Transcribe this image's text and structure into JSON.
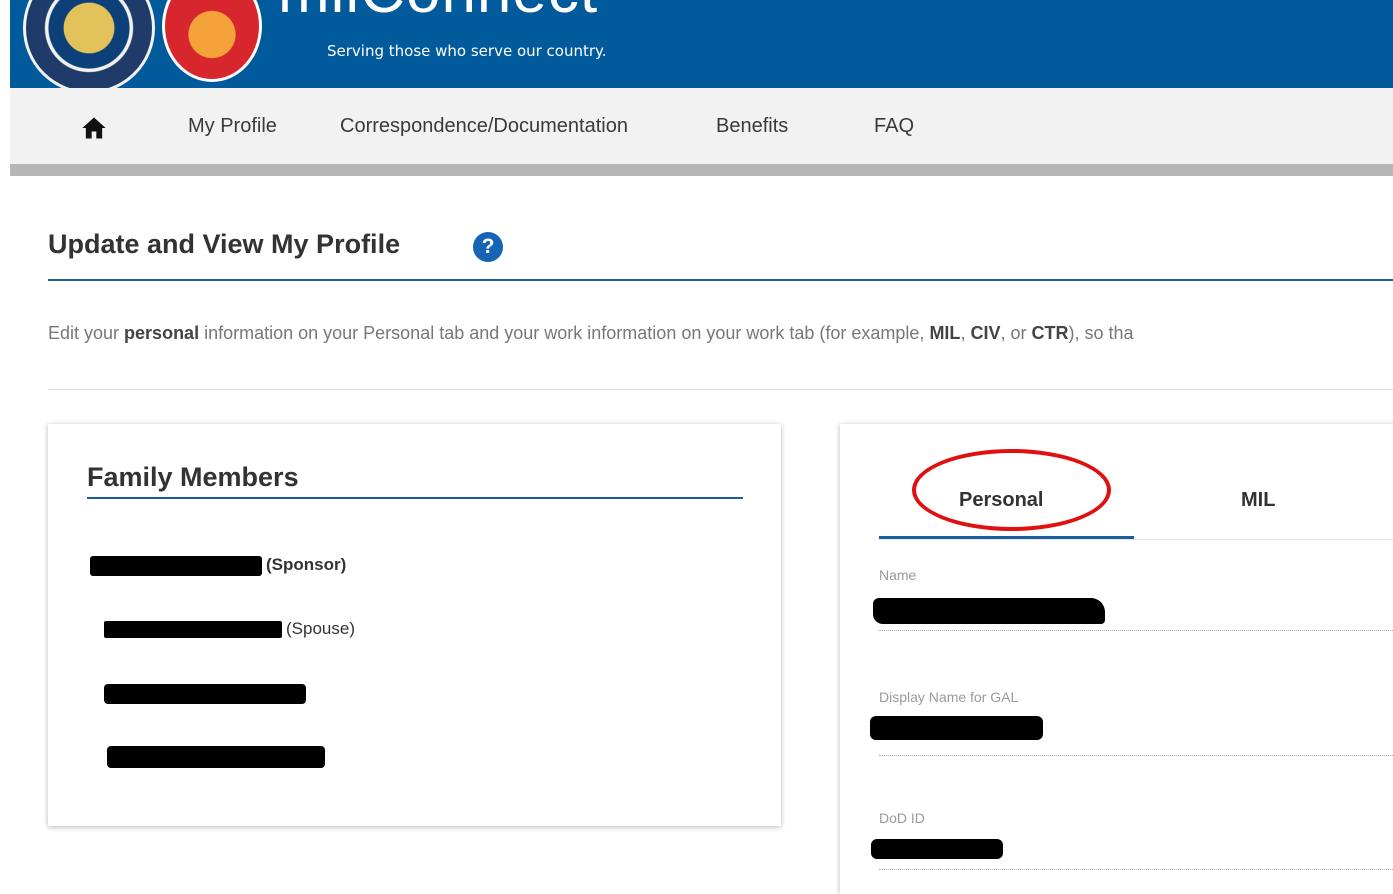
{
  "header": {
    "brand_name": "milConnect",
    "tagline": "Serving those who serve our country."
  },
  "nav": {
    "home_icon": "home-icon",
    "items": [
      "My Profile",
      "Correspondence/Documentation",
      "Benefits",
      "FAQ"
    ]
  },
  "page": {
    "title": "Update and View My Profile",
    "help_icon_text": "?",
    "intro": {
      "t1": "Edit your ",
      "b1": "personal",
      "t2": " information on your Personal tab and your work information on your work tab (for example, ",
      "b2": "MIL",
      "t3": ", ",
      "b3": "CIV",
      "t4": ", or ",
      "b4": "CTR",
      "t5": "), so tha"
    }
  },
  "family": {
    "title": "Family Members",
    "members": [
      {
        "role": "(Sponsor)"
      },
      {
        "role": "(Spouse)"
      },
      {
        "role": ""
      },
      {
        "role": ""
      }
    ]
  },
  "profile": {
    "tabs": [
      "Personal",
      "MIL"
    ],
    "active_tab": "Personal",
    "fields": [
      {
        "label": "Name"
      },
      {
        "label": "Display Name for GAL"
      },
      {
        "label": "DoD ID"
      }
    ]
  },
  "colors": {
    "header_blue": "#005a9c",
    "accent_blue": "#1b5ea0",
    "annotation_red": "#e01010"
  }
}
